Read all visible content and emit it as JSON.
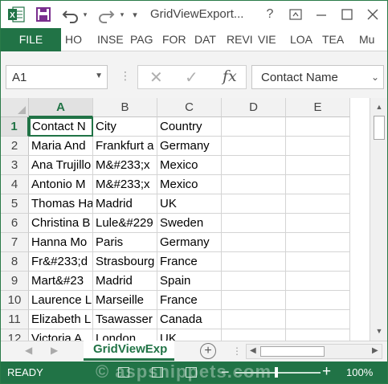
{
  "window": {
    "title": "GridViewExport...",
    "controls": [
      "?",
      "restore-ribbon",
      "minimize",
      "maximize",
      "close"
    ]
  },
  "qat": {
    "icons": [
      "excel-logo",
      "save-icon",
      "undo-icon",
      "redo-icon"
    ]
  },
  "ribbon": {
    "tabs": [
      "FILE",
      "HO",
      "INSE",
      "PAG",
      "FOR",
      "DAT",
      "REVI",
      "VIE",
      "LOA",
      "TEA",
      "Mu"
    ]
  },
  "formula_bar": {
    "name_box": "A1",
    "formula": "Contact Name",
    "fx_label": "fx",
    "cancel_glyph": "✕",
    "enter_glyph": "✓"
  },
  "sheet": {
    "columns": [
      "A",
      "B",
      "C",
      "D",
      "E"
    ],
    "rows": [
      {
        "num": "1",
        "cells": [
          "Contact N",
          "City",
          "Country"
        ]
      },
      {
        "num": "2",
        "cells": [
          "Maria And",
          "Frankfurt a",
          "Germany"
        ]
      },
      {
        "num": "3",
        "cells": [
          "Ana Trujillo",
          "M&#233;x",
          "Mexico"
        ]
      },
      {
        "num": "4",
        "cells": [
          "Antonio M",
          "M&#233;x",
          "Mexico"
        ]
      },
      {
        "num": "5",
        "cells": [
          "Thomas Ha",
          "Madrid",
          "UK"
        ]
      },
      {
        "num": "6",
        "cells": [
          "Christina B",
          "Lule&#229",
          "Sweden"
        ]
      },
      {
        "num": "7",
        "cells": [
          "Hanna Mo",
          "Paris",
          "Germany"
        ]
      },
      {
        "num": "8",
        "cells": [
          "Fr&#233;d",
          "Strasbourg",
          "France"
        ]
      },
      {
        "num": "9",
        "cells": [
          "Mart&#23",
          "Madrid",
          "Spain"
        ]
      },
      {
        "num": "10",
        "cells": [
          "Laurence L",
          "Marseille",
          "France"
        ]
      },
      {
        "num": "11",
        "cells": [
          "Elizabeth L",
          "Tsawasser",
          "Canada"
        ]
      },
      {
        "num": "12",
        "cells": [
          "Victoria A",
          "London",
          "UK"
        ]
      }
    ],
    "active_cell": "A1"
  },
  "sheet_tabs": {
    "active": "GridViewExp",
    "add_label": "+"
  },
  "status_bar": {
    "status": "READY",
    "zoom": "100%",
    "zoom_minus": "−",
    "zoom_plus": "+",
    "watermark": "© aspsnippets.com"
  },
  "colors": {
    "accent": "#217346",
    "status_bg": "#217346"
  }
}
